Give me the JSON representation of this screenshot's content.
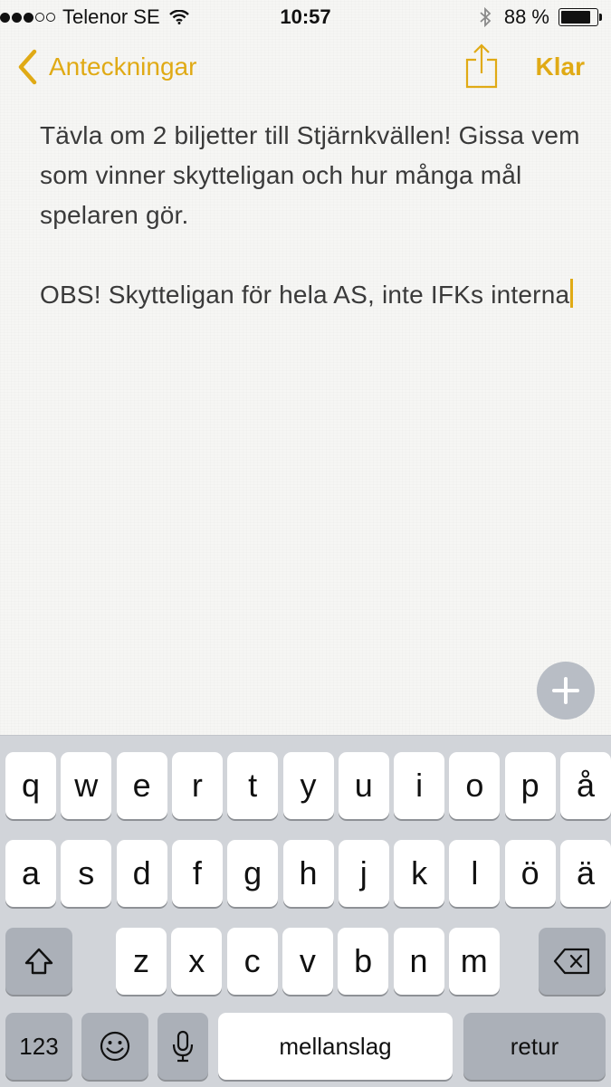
{
  "status_bar": {
    "carrier": "Telenor SE",
    "time": "10:57",
    "battery_percent": "88 %",
    "battery_level": 0.88,
    "signal_bars_filled": 3,
    "signal_bars_total": 5
  },
  "nav": {
    "back_label": "Anteckningar",
    "done_label": "Klar"
  },
  "note": {
    "paragraph_1": "Tävla om 2 biljetter till Stjärnkvällen! Gissa vem som vinner skytteligan och hur många mål spelaren gör.",
    "paragraph_2": "OBS! Skytteligan för hela AS, inte IFKs interna"
  },
  "keyboard": {
    "row1": [
      "q",
      "w",
      "e",
      "r",
      "t",
      "y",
      "u",
      "i",
      "o",
      "p",
      "å"
    ],
    "row2": [
      "a",
      "s",
      "d",
      "f",
      "g",
      "h",
      "j",
      "k",
      "l",
      "ö",
      "ä"
    ],
    "row3": [
      "z",
      "x",
      "c",
      "v",
      "b",
      "n",
      "m"
    ],
    "numbers_label": "123",
    "space_label": "mellanslag",
    "return_label": "retur"
  },
  "colors": {
    "accent": "#e0aa15",
    "keyboard_bg": "#d1d4d9",
    "special_key": "#abb0b8"
  },
  "icons": [
    "back-chevron-icon",
    "share-icon",
    "add-icon",
    "shift-icon",
    "delete-icon",
    "emoji-icon",
    "microphone-icon",
    "wifi-icon",
    "bluetooth-icon",
    "battery-icon"
  ]
}
